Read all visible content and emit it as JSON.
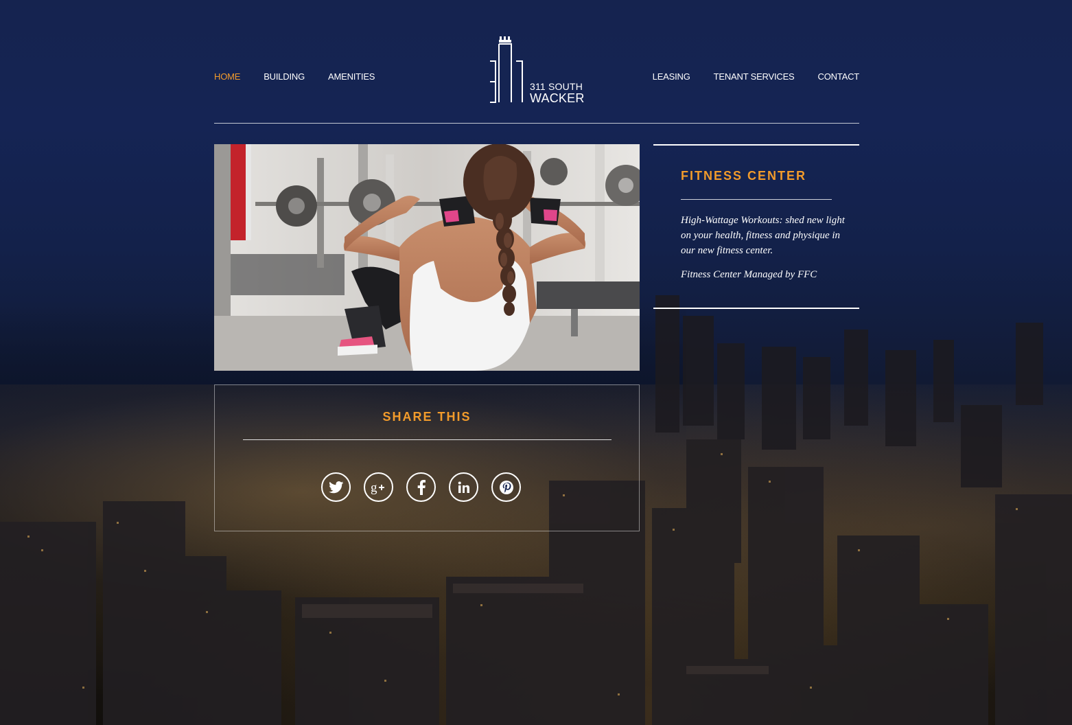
{
  "nav": {
    "left": [
      {
        "label": "HOME",
        "active": true
      },
      {
        "label": "BUILDING",
        "active": false
      },
      {
        "label": "AMENITIES",
        "active": false
      }
    ],
    "right": [
      {
        "label": "LEASING",
        "active": false
      },
      {
        "label": "TENANT SERVICES",
        "active": false
      },
      {
        "label": "CONTACT",
        "active": false
      }
    ]
  },
  "logo": {
    "line1": "311 SOUTH",
    "line2": "WACKER"
  },
  "panel": {
    "title": "FITNESS CENTER",
    "description": "High-Wattage Workouts: shed new light on your health, fitness and physique in our new fitness center.",
    "managed": "Fitness Center Managed by FFC"
  },
  "share": {
    "title": "SHARE THIS",
    "icons": [
      "twitter-icon",
      "google-plus-icon",
      "facebook-icon",
      "linkedin-icon",
      "pinterest-icon"
    ]
  },
  "colors": {
    "accent": "#f29b2b",
    "background": "#15234f",
    "text": "#ffffff"
  }
}
